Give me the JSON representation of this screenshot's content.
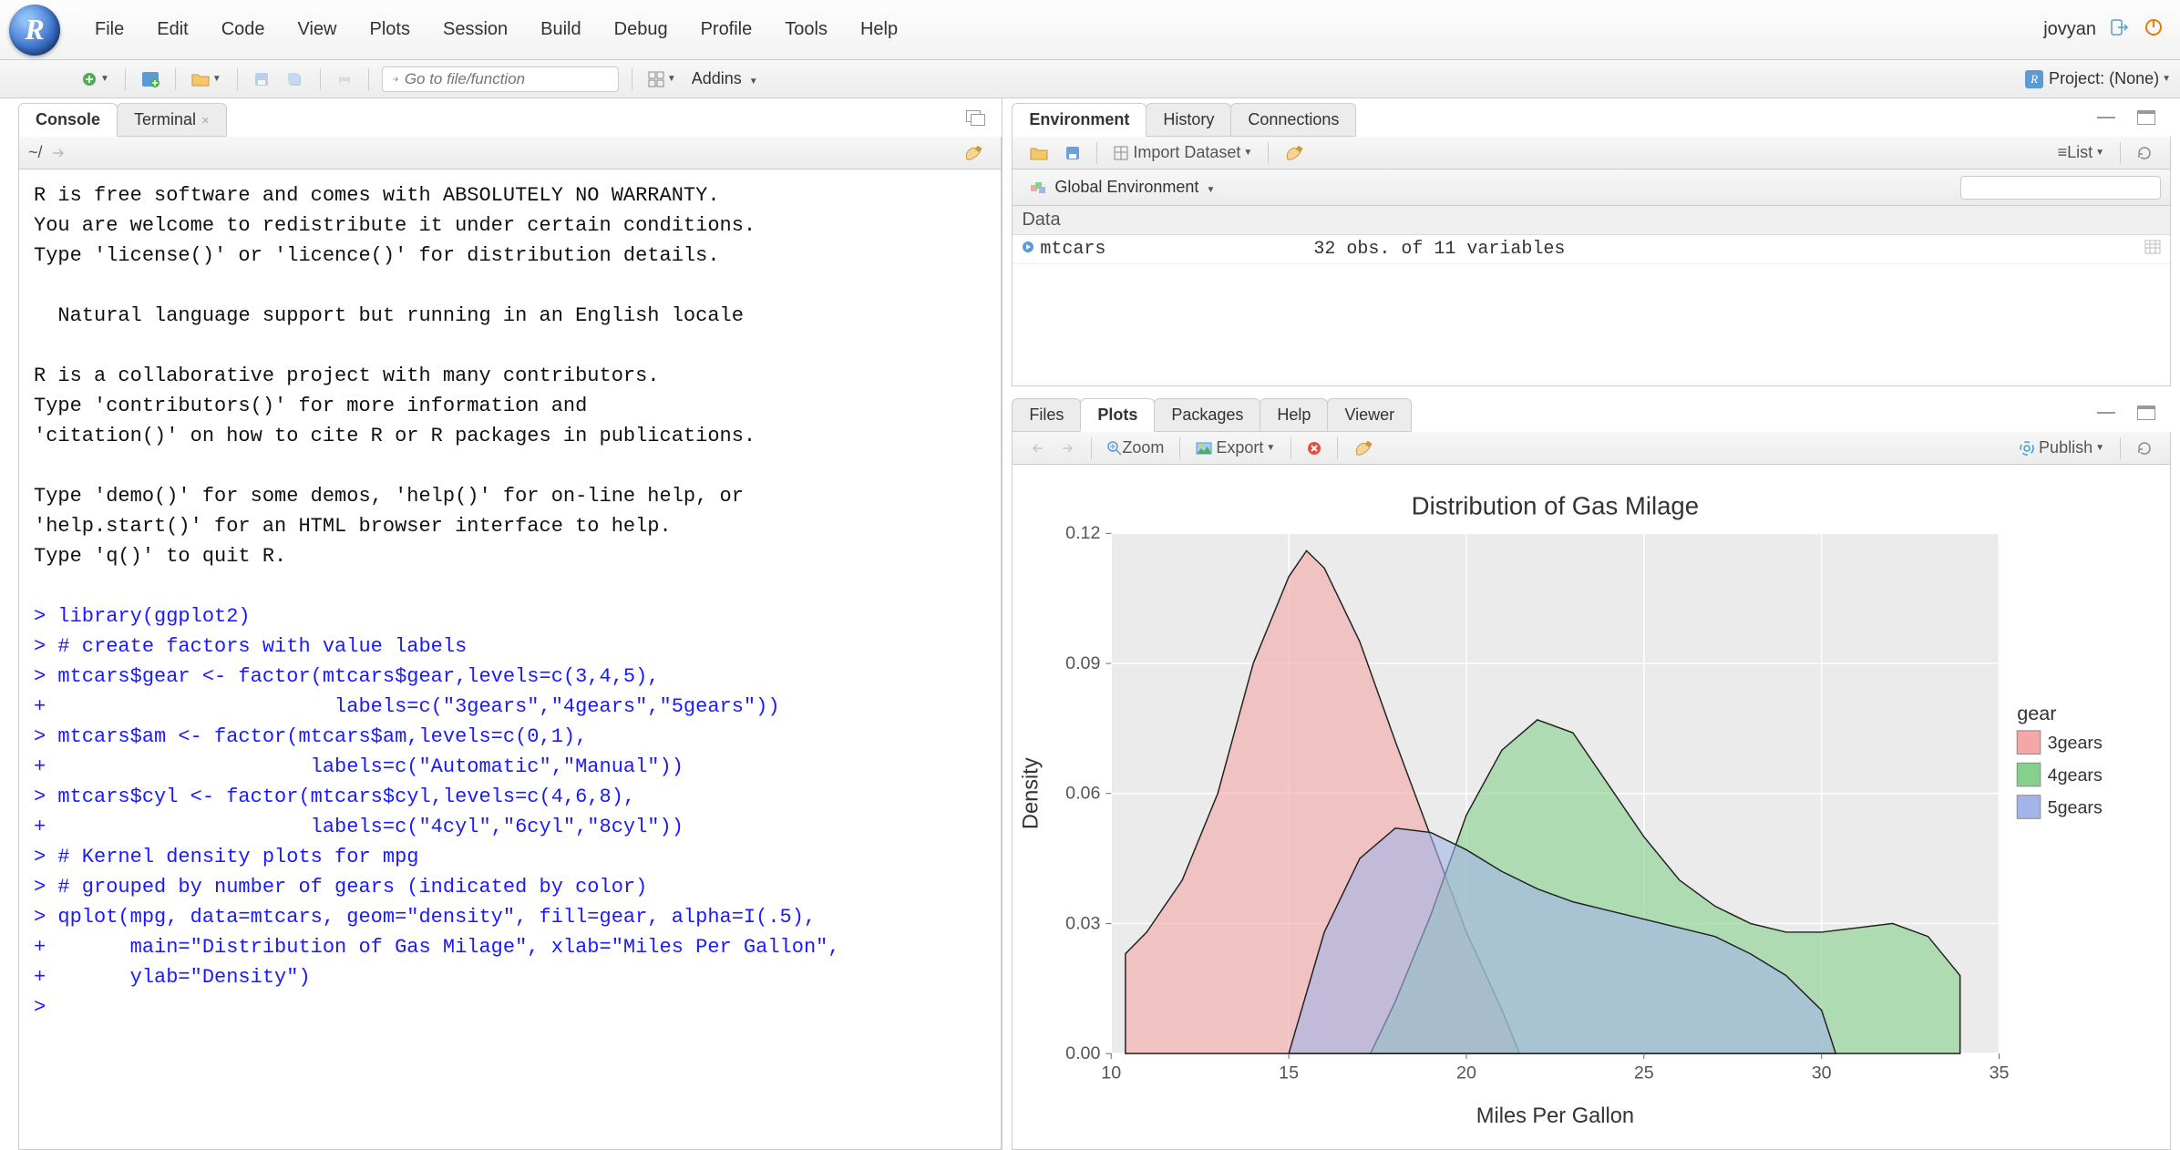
{
  "menu": {
    "items": [
      "File",
      "Edit",
      "Code",
      "View",
      "Plots",
      "Session",
      "Build",
      "Debug",
      "Profile",
      "Tools",
      "Help"
    ],
    "user": "jovyan"
  },
  "toolbar": {
    "goto_placeholder": "Go to file/function",
    "addins": "Addins",
    "project": "Project: (None)"
  },
  "left": {
    "tabs": [
      "Console",
      "Terminal"
    ],
    "active_tab": 0,
    "wd": "~/",
    "console_plain": "R is free software and comes with ABSOLUTELY NO WARRANTY.\nYou are welcome to redistribute it under certain conditions.\nType 'license()' or 'licence()' for distribution details.\n\n  Natural language support but running in an English locale\n\nR is a collaborative project with many contributors.\nType 'contributors()' for more information and\n'citation()' on how to cite R or R packages in publications.\n\nType 'demo()' for some demos, 'help()' for on-line help, or\n'help.start()' for an HTML browser interface to help.\nType 'q()' to quit R.\n",
    "console_cmd": "> library(ggplot2)\n> # create factors with value labels\n> mtcars$gear <- factor(mtcars$gear,levels=c(3,4,5),\n+                        labels=c(\"3gears\",\"4gears\",\"5gears\"))\n> mtcars$am <- factor(mtcars$am,levels=c(0,1),\n+                      labels=c(\"Automatic\",\"Manual\"))\n> mtcars$cyl <- factor(mtcars$cyl,levels=c(4,6,8),\n+                      labels=c(\"4cyl\",\"6cyl\",\"8cyl\"))\n> # Kernel density plots for mpg\n> # grouped by number of gears (indicated by color)\n> qplot(mpg, data=mtcars, geom=\"density\", fill=gear, alpha=I(.5),\n+       main=\"Distribution of Gas Milage\", xlab=\"Miles Per Gallon\",\n+       ylab=\"Density\")\n> "
  },
  "env": {
    "tabs": [
      "Environment",
      "History",
      "Connections"
    ],
    "active_tab": 0,
    "import": "Import Dataset",
    "list_mode": "List",
    "scope": "Global Environment",
    "section": "Data",
    "rows": [
      {
        "name": "mtcars",
        "value": "32 obs. of 11 variables"
      }
    ]
  },
  "plots": {
    "tabs": [
      "Files",
      "Plots",
      "Packages",
      "Help",
      "Viewer"
    ],
    "active_tab": 1,
    "zoom": "Zoom",
    "export": "Export",
    "publish": "Publish"
  },
  "chart_data": {
    "type": "area",
    "title": "Distribution of Gas Milage",
    "xlabel": "Miles Per Gallon",
    "ylabel": "Density",
    "legend_title": "gear",
    "xlim": [
      10,
      35
    ],
    "ylim": [
      0,
      0.12
    ],
    "x_ticks": [
      10,
      15,
      20,
      25,
      30,
      35
    ],
    "y_ticks": [
      0.0,
      0.03,
      0.06,
      0.09,
      0.12
    ],
    "series": [
      {
        "name": "3gears",
        "color": "#f5a6a6",
        "x": [
          10.4,
          11,
          12,
          13,
          14,
          15,
          15.5,
          16,
          17,
          18,
          19,
          20,
          21,
          21.5
        ],
        "values": [
          0.023,
          0.028,
          0.04,
          0.06,
          0.09,
          0.11,
          0.116,
          0.112,
          0.095,
          0.072,
          0.05,
          0.028,
          0.01,
          0.0
        ]
      },
      {
        "name": "4gears",
        "color": "#85d08b",
        "x": [
          17.3,
          18,
          19,
          20,
          21,
          22,
          23,
          24,
          25,
          26,
          27,
          28,
          29,
          30,
          31,
          32,
          33,
          33.9
        ],
        "values": [
          0.0,
          0.012,
          0.032,
          0.055,
          0.07,
          0.077,
          0.074,
          0.062,
          0.05,
          0.04,
          0.034,
          0.03,
          0.028,
          0.028,
          0.029,
          0.03,
          0.027,
          0.018
        ]
      },
      {
        "name": "5gears",
        "color": "#a3b4e8",
        "x": [
          15,
          16,
          17,
          18,
          19,
          20,
          21,
          22,
          23,
          24,
          25,
          26,
          27,
          28,
          29,
          30,
          30.4
        ],
        "values": [
          0.0,
          0.028,
          0.045,
          0.052,
          0.051,
          0.047,
          0.042,
          0.038,
          0.035,
          0.033,
          0.031,
          0.029,
          0.027,
          0.023,
          0.018,
          0.01,
          0.0
        ]
      }
    ]
  }
}
